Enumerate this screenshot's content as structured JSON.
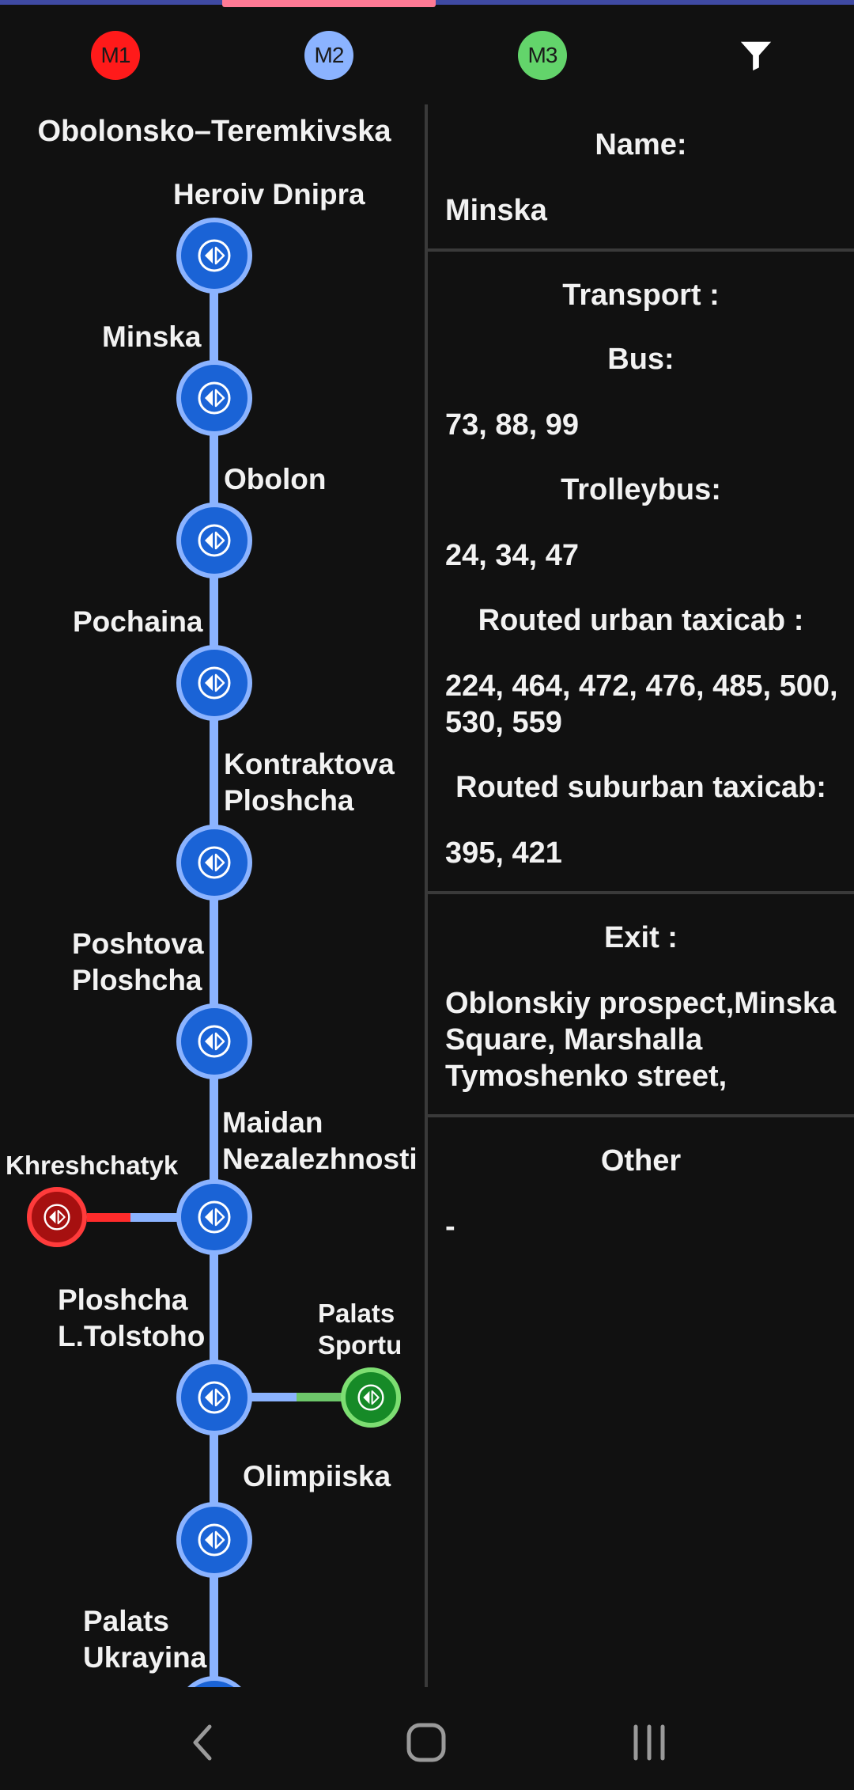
{
  "tabs": [
    {
      "label": "M1",
      "color": "#ff1a1a",
      "text_color": "#ffffff"
    },
    {
      "label": "M2",
      "color": "#8bb3ff",
      "text_color": "#1a1a1a"
    },
    {
      "label": "M3",
      "color": "#63d46b",
      "text_color": "#1a1a1a"
    }
  ],
  "filter_icon": "funnel-icon",
  "line": {
    "title": "Obolonsko–Teremkivska",
    "color": "#8bb3ff",
    "stations": [
      {
        "name": "Heroiv Dnipra"
      },
      {
        "name": "Minska"
      },
      {
        "name": "Obolon"
      },
      {
        "name": "Pochaina"
      },
      {
        "name": "Kontraktova Ploshcha"
      },
      {
        "name": "Poshtova Ploshcha"
      },
      {
        "name": "Maidan Nezalezhnosti",
        "transfer": "Khreshchatyk"
      },
      {
        "name": "Ploshcha L.Tolstoho",
        "transfer": "Palats Sportu"
      },
      {
        "name": "Olimpiiska"
      },
      {
        "name": "Palats Ukrayina"
      }
    ]
  },
  "details": {
    "name_title": "Name:",
    "name_value": "Minska",
    "transport_title": "Transport :",
    "bus_title": "Bus:",
    "bus_value": "73, 88, 99",
    "trolleybus_title": "Trolleybus:",
    "trolleybus_value": "24, 34, 47",
    "urban_taxi_title": "Routed urban taxicab :",
    "urban_taxi_value": "224, 464, 472, 476, 485, 500, 530, 559",
    "suburban_taxi_title": "Routed suburban taxicab:",
    "suburban_taxi_value": "395, 421",
    "exit_title": "Exit :",
    "exit_value": "Oblonskiy prospect,Minska Square, Marshalla Tymoshenko street,",
    "other_title": "Other",
    "other_value": "-"
  },
  "navbar": {
    "back": "back-icon",
    "home": "home-icon",
    "recents": "recents-icon"
  }
}
